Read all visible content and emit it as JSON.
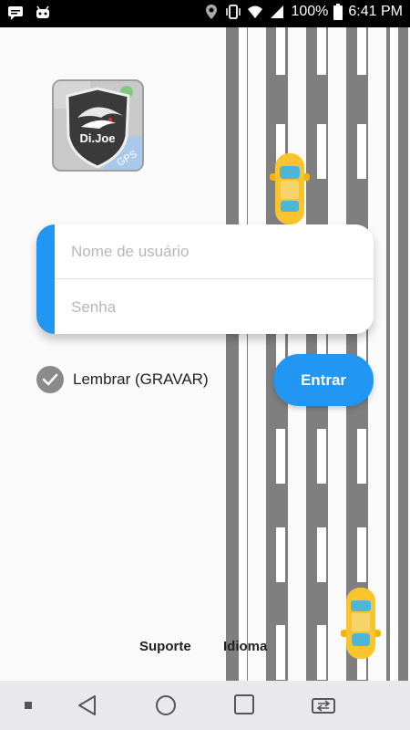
{
  "status_bar": {
    "battery": "100%",
    "time": "6:41 PM",
    "icons": [
      "message-icon",
      "android-icon",
      "location-icon",
      "vibrate-icon",
      "wifi-icon",
      "signal-icon",
      "battery-icon"
    ]
  },
  "logo": {
    "text": "Di.Joe",
    "badge": "GPS"
  },
  "form": {
    "username_placeholder": "Nome de usuário",
    "password_placeholder": "Senha"
  },
  "remember_label": "Lembrar (GRAVAR)",
  "enter_label": "Entrar",
  "footer": {
    "support": "Suporte",
    "language": "Idioma"
  },
  "nav_bar": {
    "icons": [
      "recent-dot-icon",
      "back-icon",
      "home-icon",
      "overview-icon",
      "switch-apps-icon"
    ]
  },
  "colors": {
    "accent": "#2196f3",
    "road": "#7f7f7f",
    "car": "#f9c42c"
  }
}
